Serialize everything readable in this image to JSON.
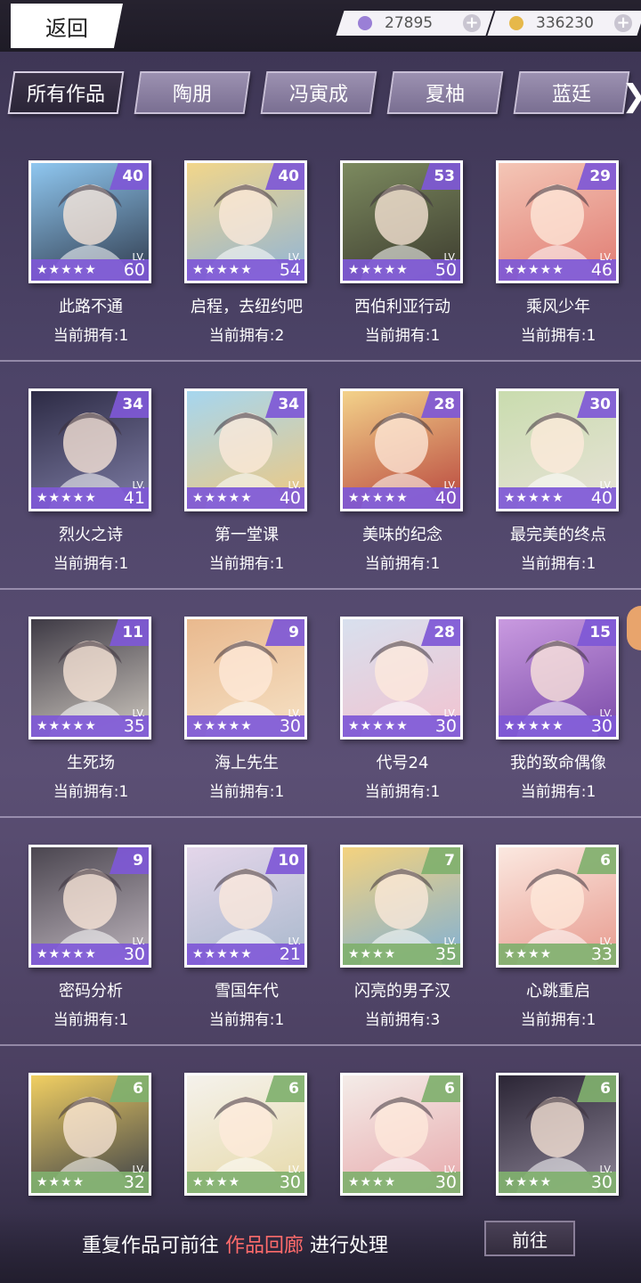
{
  "topbar": {
    "back_label": "返回",
    "diamond": {
      "value": "27895",
      "color": "#9a7fd6"
    },
    "gold": {
      "value": "336230",
      "color": "#e6b84a"
    },
    "plus": "+"
  },
  "tabs": [
    "所有作品",
    "陶朋",
    "冯寅成",
    "夏柚",
    "蓝廷"
  ],
  "tab_next": "❯",
  "own_prefix": "当前拥有:",
  "lv_label": "LV.",
  "cards": [
    {
      "title": "此路不通",
      "count": 1,
      "badge": "40",
      "stars": "★★★★★",
      "lv": "60",
      "rarity": "purple",
      "bg": [
        "#8fc7f0",
        "#2f3a4c"
      ]
    },
    {
      "title": "启程，去纽约吧",
      "count": 2,
      "badge": "40",
      "stars": "★★★★★",
      "lv": "54",
      "rarity": "purple",
      "bg": [
        "#f2d68a",
        "#8fb4d8"
      ]
    },
    {
      "title": "西伯利亚行动",
      "count": 1,
      "badge": "53",
      "stars": "★★★★★",
      "lv": "50",
      "rarity": "purple",
      "bg": [
        "#7c8a5f",
        "#3c3b2e"
      ]
    },
    {
      "title": "乘风少年",
      "count": 1,
      "badge": "29",
      "stars": "★★★★★",
      "lv": "46",
      "rarity": "purple",
      "bg": [
        "#f4c6b6",
        "#e07b72"
      ]
    },
    {
      "title": "烈火之诗",
      "count": 1,
      "badge": "34",
      "stars": "★★★★★",
      "lv": "41",
      "rarity": "purple",
      "bg": [
        "#2d2b45",
        "#7f7ea6"
      ]
    },
    {
      "title": "第一堂课",
      "count": 1,
      "badge": "34",
      "stars": "★★★★★",
      "lv": "40",
      "rarity": "purple",
      "bg": [
        "#a6d6ef",
        "#f0c87e"
      ]
    },
    {
      "title": "美味的纪念",
      "count": 1,
      "badge": "28",
      "stars": "★★★★★",
      "lv": "40",
      "rarity": "purple",
      "bg": [
        "#f3d28a",
        "#b8453d"
      ]
    },
    {
      "title": "最完美的终点",
      "count": 1,
      "badge": "30",
      "stars": "★★★★★",
      "lv": "40",
      "rarity": "purple",
      "bg": [
        "#c9dcae",
        "#e8e2d8"
      ]
    },
    {
      "title": "生死场",
      "count": 1,
      "badge": "11",
      "stars": "★★★★★",
      "lv": "35",
      "rarity": "purple",
      "bg": [
        "#3e3a45",
        "#cfc9c0"
      ]
    },
    {
      "title": "海上先生",
      "count": 1,
      "badge": "9",
      "stars": "★★★★★",
      "lv": "30",
      "rarity": "purple",
      "bg": [
        "#e9b98e",
        "#f6e2c6"
      ]
    },
    {
      "title": "代号24",
      "count": 1,
      "badge": "28",
      "stars": "★★★★★",
      "lv": "30",
      "rarity": "purple",
      "bg": [
        "#d8e0ee",
        "#f2c2cf"
      ]
    },
    {
      "title": "我的致命偶像",
      "count": 1,
      "badge": "15",
      "stars": "★★★★★",
      "lv": "30",
      "rarity": "purple",
      "bg": [
        "#c99ae0",
        "#7a4aa8"
      ]
    },
    {
      "title": "密码分析",
      "count": 1,
      "badge": "9",
      "stars": "★★★★★",
      "lv": "30",
      "rarity": "purple",
      "bg": [
        "#4b4650",
        "#bfb6be"
      ]
    },
    {
      "title": "雪国年代",
      "count": 1,
      "badge": "10",
      "stars": "★★★★★",
      "lv": "21",
      "rarity": "purple",
      "bg": [
        "#e4d6ea",
        "#a8b8cc"
      ]
    },
    {
      "title": "闪亮的男子汉",
      "count": 3,
      "badge": "7",
      "stars": "★★★★",
      "lv": "35",
      "rarity": "green",
      "bg": [
        "#f4d27e",
        "#7fb0d6"
      ]
    },
    {
      "title": "心跳重启",
      "count": 1,
      "badge": "6",
      "stars": "★★★★",
      "lv": "33",
      "rarity": "green",
      "bg": [
        "#fbe8e0",
        "#e79a8e"
      ]
    },
    {
      "title": "",
      "count": null,
      "badge": "6",
      "stars": "★★★★",
      "lv": "32",
      "rarity": "green",
      "bg": [
        "#f1cf62",
        "#3a3f48"
      ]
    },
    {
      "title": "",
      "count": null,
      "badge": "6",
      "stars": "★★★★",
      "lv": "30",
      "rarity": "green",
      "bg": [
        "#f5f2ec",
        "#e6d9a8"
      ]
    },
    {
      "title": "",
      "count": null,
      "badge": "6",
      "stars": "★★★★",
      "lv": "30",
      "rarity": "green",
      "bg": [
        "#f4ece8",
        "#e7a9ac"
      ]
    },
    {
      "title": "",
      "count": null,
      "badge": "6",
      "stars": "★★★★",
      "lv": "30",
      "rarity": "green",
      "bg": [
        "#2b2535",
        "#8c8496"
      ]
    }
  ],
  "footer": {
    "text_before": "重复作品可前往",
    "highlight": "作品回廊",
    "text_after": "进行处理",
    "goto_label": "前往"
  }
}
